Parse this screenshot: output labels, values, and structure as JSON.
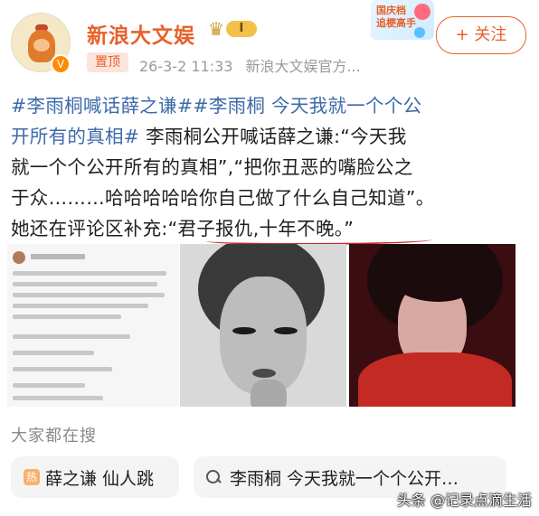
{
  "header": {
    "username": "新浪大文娱",
    "level_badge": "I",
    "pinned_label": "置顶",
    "timestamp": "26-3-2 11:33",
    "source": "新浪大文娱官方...",
    "follow_label": "+ 关注",
    "promo_text_line1": "国庆档",
    "promo_text_line2": "追梗高手",
    "verified_icon": "V"
  },
  "post": {
    "line1_tag1": "#李雨桐喊话薛之谦##李雨桐 今天我就一个个公",
    "line2_tag_cont": "开所有的真相#",
    "line2_text": " 李雨桐公开喊话薛之谦:“今天我",
    "line3": "就一个个公开所有的真相”,“把你丑恶的嘴脸公之",
    "line4": "于众………哈哈哈哈哈你自己做了什么自己知道”。",
    "line5": "她还在评论区补充:“君子报仇,十年不晚。”"
  },
  "search": {
    "section_label": "大家都在搜",
    "chip1": "薛之谦 仙人跳",
    "chip2": "李雨桐 今天我就一个个公开…",
    "hot_icon_glyph": "热"
  },
  "watermark": "头条 @记录点滴生活",
  "colors": {
    "brand_orange": "#e8612a",
    "hashtag_blue": "#3d6aa8",
    "underline_red": "#c22a2a"
  }
}
